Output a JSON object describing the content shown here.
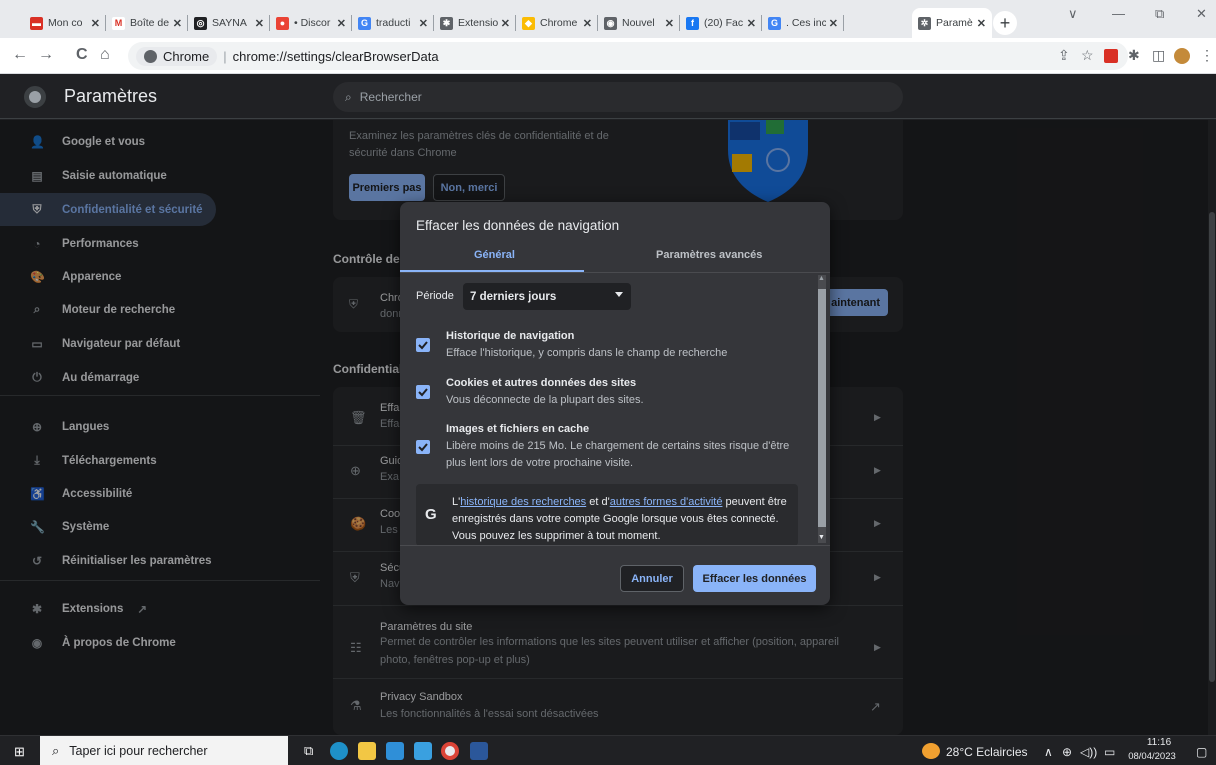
{
  "browser": {
    "tabs": [
      {
        "title": "Mon co",
        "favicon_color": "#d93025",
        "favicon_glyph": "▬"
      },
      {
        "title": "Boîte de",
        "favicon_color": "#ffffff",
        "favicon_glyph": "M"
      },
      {
        "title": "SAYNA",
        "favicon_color": "#202124",
        "favicon_glyph": "◎"
      },
      {
        "title": "• Discor",
        "favicon_color": "#ea4335",
        "favicon_glyph": "●"
      },
      {
        "title": "traducti",
        "favicon_color": "#4285f4",
        "favicon_glyph": "G"
      },
      {
        "title": "Extensio",
        "favicon_color": "#5f6368",
        "favicon_glyph": "✱"
      },
      {
        "title": "Chrome",
        "favicon_color": "#fbbc04",
        "favicon_glyph": "◆"
      },
      {
        "title": "Nouvel",
        "favicon_color": "#5f6368",
        "favicon_glyph": "◉"
      },
      {
        "title": "(20) Fac",
        "favicon_color": "#1877f2",
        "favicon_glyph": "f"
      },
      {
        "title": ". Ces inc",
        "favicon_color": "#4285f4",
        "favicon_glyph": "G"
      },
      {
        "title": "Paramè",
        "favicon_color": "#5f6368",
        "favicon_glyph": "✲"
      }
    ],
    "new_tab_label": "+",
    "window_controls": [
      "∨",
      "—",
      "⧉",
      "✕"
    ],
    "url_origin": "Chrome",
    "url_path": "chrome://settings/clearBrowserData",
    "nav_icons": [
      "←",
      "→",
      "C",
      "⌂"
    ]
  },
  "settings": {
    "title": "Paramètres",
    "search_placeholder": "Rechercher",
    "nav": [
      {
        "label": "Google et vous",
        "icon": "👤"
      },
      {
        "label": "Saisie automatique",
        "icon": "▤"
      },
      {
        "label": "Confidentialité et sécurité",
        "icon": "⛨"
      },
      {
        "label": "Performances",
        "icon": "◔"
      },
      {
        "label": "Apparence",
        "icon": "🎨"
      },
      {
        "label": "Moteur de recherche",
        "icon": "⌕"
      },
      {
        "label": "Navigateur par défaut",
        "icon": "▭"
      },
      {
        "label": "Au démarrage",
        "icon": "⏻"
      },
      {
        "label": "Langues",
        "icon": "⊕"
      },
      {
        "label": "Téléchargements",
        "icon": "⤓"
      },
      {
        "label": "Accessibilité",
        "icon": "♿"
      },
      {
        "label": "Système",
        "icon": "🔧"
      },
      {
        "label": "Réinitialiser les paramètres",
        "icon": "↺"
      },
      {
        "label": "Extensions",
        "icon": "✱",
        "ext_icon": "↗"
      },
      {
        "label": "À propos de Chrome",
        "icon": "◉"
      }
    ],
    "promo": {
      "text": "Examinez les paramètres clés de confidentialité et de sécurité dans Chrome",
      "primary_btn": "Premiers pas",
      "secondary_btn": "Non, merci"
    },
    "section_safety": "Contrôle de",
    "safety_row": {
      "line1": "Chro",
      "line2": "donn",
      "btn": "aintenant"
    },
    "section_privacy": "Confidential",
    "rows": [
      {
        "l1": "Effa",
        "l2": "Effa",
        "icon": "🗑"
      },
      {
        "l1": "Guid",
        "l2": "Exa",
        "icon": "⊕"
      },
      {
        "l1": "Coo",
        "l2": "Les",
        "icon": "🍪"
      },
      {
        "l1": "Sécu",
        "l2": "Nav",
        "icon": "⛨"
      }
    ],
    "site_settings": {
      "title": "Paramètres du site",
      "desc1": "Permet de contrôler les informations que les sites peuvent utiliser et afficher (position, appareil",
      "desc2": "photo, fenêtres pop-up et plus)"
    },
    "privacy_sandbox": {
      "title": "Privacy Sandbox",
      "desc": "Les fonctionnalités à l'essai sont désactivées"
    }
  },
  "dialog": {
    "title": "Effacer les données de navigation",
    "tab_basic": "Général",
    "tab_advanced": "Paramètres avancés",
    "period_label": "Période",
    "period_value": "7 derniers jours",
    "items": [
      {
        "title": "Historique de navigation",
        "desc": "Efface l'historique, y compris dans le champ de recherche",
        "checked": true
      },
      {
        "title": "Cookies et autres données des sites",
        "desc": "Vous déconnecte de la plupart des sites.",
        "checked": true
      },
      {
        "title": "Images et fichiers en cache",
        "desc": "Libère moins de 215 Mo. Le chargement de certains sites risque d'être plus lent lors de votre prochaine visite.",
        "checked": true
      }
    ],
    "google_note": {
      "icon": "G",
      "prefix": "L'",
      "link1": "historique des recherches",
      "mid": " et d'",
      "link2": "autres formes d'activité",
      "suffix": " peuvent être enregistrés dans votre compte Google lorsque vous êtes connecté. Vous pouvez les supprimer à tout moment."
    },
    "cancel_btn": "Annuler",
    "confirm_btn": "Effacer les données"
  },
  "taskbar": {
    "search_placeholder": "Taper ici pour rechercher",
    "weather": "28°C  Eclaircies",
    "time": "11:16",
    "date": "08/04/2023"
  },
  "colors": {
    "accent": "#8ab4f8",
    "bg": "#202124",
    "card": "#292a2d",
    "dialog": "#35363a"
  }
}
